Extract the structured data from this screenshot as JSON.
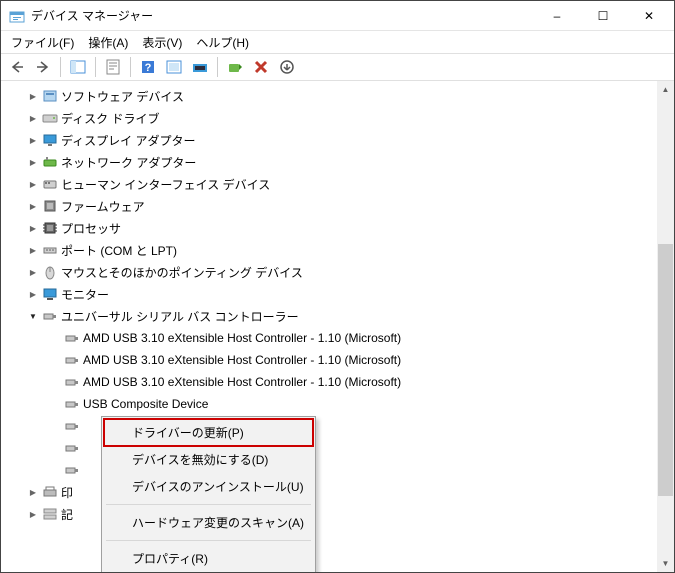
{
  "title": "デバイス マネージャー",
  "win": {
    "min": "–",
    "max": "☐",
    "close": "✕"
  },
  "menus": [
    {
      "label": "ファイル(F)"
    },
    {
      "label": "操作(A)"
    },
    {
      "label": "表示(V)"
    },
    {
      "label": "ヘルプ(H)"
    }
  ],
  "tree": [
    {
      "level": 0,
      "exp": "right",
      "icon": "software",
      "label": "ソフトウェア デバイス"
    },
    {
      "level": 0,
      "exp": "right",
      "icon": "disk",
      "label": "ディスク ドライブ"
    },
    {
      "level": 0,
      "exp": "right",
      "icon": "display",
      "label": "ディスプレイ アダプター"
    },
    {
      "level": 0,
      "exp": "right",
      "icon": "network",
      "label": "ネットワーク アダプター"
    },
    {
      "level": 0,
      "exp": "right",
      "icon": "hid",
      "label": "ヒューマン インターフェイス デバイス"
    },
    {
      "level": 0,
      "exp": "right",
      "icon": "firmware",
      "label": "ファームウェア"
    },
    {
      "level": 0,
      "exp": "right",
      "icon": "cpu",
      "label": "プロセッサ"
    },
    {
      "level": 0,
      "exp": "right",
      "icon": "port",
      "label": "ポート (COM と LPT)"
    },
    {
      "level": 0,
      "exp": "right",
      "icon": "mouse",
      "label": "マウスとそのほかのポインティング デバイス"
    },
    {
      "level": 0,
      "exp": "right",
      "icon": "monitor",
      "label": "モニター"
    },
    {
      "level": 0,
      "exp": "down",
      "icon": "usb",
      "label": "ユニバーサル シリアル バス コントローラー"
    },
    {
      "level": 1,
      "exp": "",
      "icon": "usb-dev",
      "label": "AMD USB 3.10 eXtensible Host Controller - 1.10 (Microsoft)"
    },
    {
      "level": 1,
      "exp": "",
      "icon": "usb-dev",
      "label": "AMD USB 3.10 eXtensible Host Controller - 1.10 (Microsoft)"
    },
    {
      "level": 1,
      "exp": "",
      "icon": "usb-dev",
      "label": "AMD USB 3.10 eXtensible Host Controller - 1.10 (Microsoft)"
    },
    {
      "level": 1,
      "exp": "",
      "icon": "usb-dev",
      "label": "USB Composite Device"
    },
    {
      "level": 1,
      "exp": "",
      "icon": "usb-dev",
      "label": ""
    },
    {
      "level": 1,
      "exp": "",
      "icon": "usb-dev",
      "label": ""
    },
    {
      "level": 1,
      "exp": "",
      "icon": "usb-dev",
      "label": ""
    },
    {
      "level": 0,
      "exp": "right",
      "icon": "printq",
      "label": "印"
    },
    {
      "level": 0,
      "exp": "right",
      "icon": "storage",
      "label": "記"
    }
  ],
  "ctx": {
    "items": [
      {
        "label": "ドライバーの更新(P)",
        "hl": true
      },
      {
        "label": "デバイスを無効にする(D)"
      },
      {
        "label": "デバイスのアンインストール(U)"
      }
    ],
    "items2": [
      {
        "label": "ハードウェア変更のスキャン(A)"
      }
    ],
    "items3": [
      {
        "label": "プロパティ(R)"
      }
    ]
  }
}
